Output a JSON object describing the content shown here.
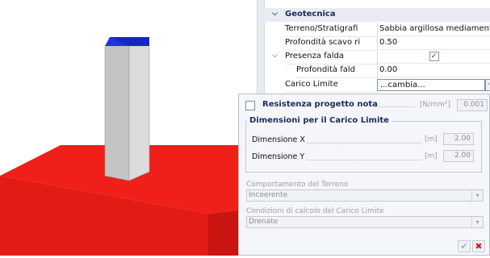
{
  "property_grid": {
    "category": "Geotecnica",
    "rows": [
      {
        "name": "Terreno/Stratigrafi",
        "value": "Sabbia argillosa mediamente consc"
      },
      {
        "name": "Profondità scavo ri",
        "value": "0.50"
      },
      {
        "name": "Presenza falda",
        "value": "✓"
      },
      {
        "name": "Profondità fald",
        "value": "0.00"
      },
      {
        "name": "Carico Limite",
        "value": "...cambia..."
      }
    ],
    "ellipsis": "···"
  },
  "dialog": {
    "resistenza_label": "Resistenza progetto nota",
    "resistenza_unit": "[N/mm²]",
    "resistenza_value": "0.001",
    "group_title": "Dimensioni per il Carico Limite",
    "dim_x_label": "Dimensione X",
    "dim_x_unit": "[m]",
    "dim_x_value": "2.00",
    "dim_y_label": "Dimensione Y",
    "dim_y_unit": "[m]",
    "dim_y_value": "2.00",
    "comportamento_label": "Comportamento del Terreno",
    "comportamento_value": "Incoerente",
    "condizioni_label": "Condizioni di calcolo del Carico Limite",
    "condizioni_value": "Drenate",
    "ok_glyph": "✔",
    "cancel_glyph": "✖"
  },
  "colors": {
    "footing": "#e8201a",
    "column": "#c9c9c9",
    "column_top": "#1e2fd6",
    "accent": "#1b2d5e"
  }
}
